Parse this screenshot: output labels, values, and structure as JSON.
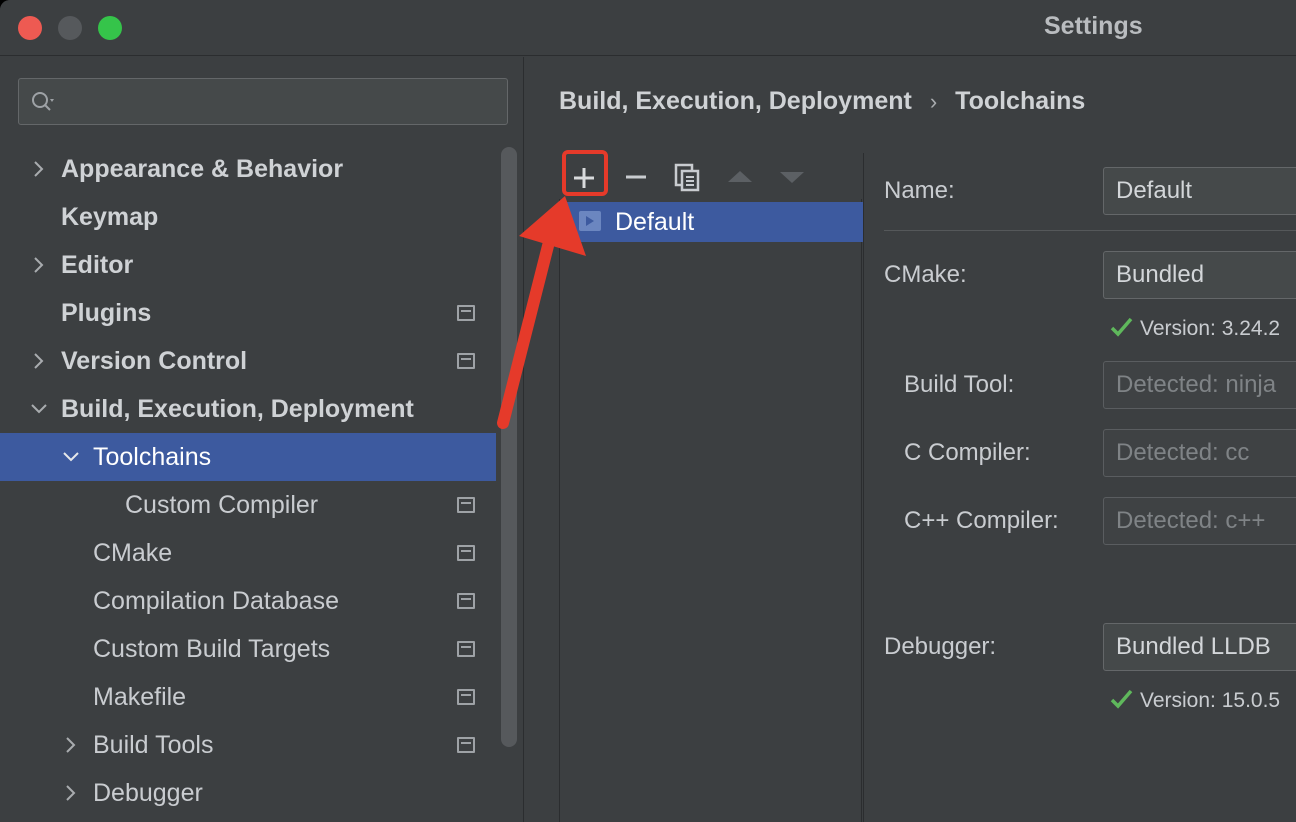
{
  "window": {
    "title": "Settings"
  },
  "search": {
    "placeholder": ""
  },
  "sidebar": {
    "items": [
      {
        "label": "Appearance & Behavior",
        "expandable": true,
        "expanded": false,
        "bold": true,
        "project_icon": false
      },
      {
        "label": "Keymap",
        "expandable": false,
        "bold": true,
        "project_icon": false
      },
      {
        "label": "Editor",
        "expandable": true,
        "expanded": false,
        "bold": true,
        "project_icon": false
      },
      {
        "label": "Plugins",
        "expandable": false,
        "bold": true,
        "project_icon": true
      },
      {
        "label": "Version Control",
        "expandable": true,
        "expanded": false,
        "bold": true,
        "project_icon": true
      },
      {
        "label": "Build, Execution, Deployment",
        "expandable": true,
        "expanded": true,
        "bold": true,
        "project_icon": false
      },
      {
        "label": "Toolchains",
        "expandable": true,
        "expanded": true,
        "selected": true,
        "project_icon": false
      },
      {
        "label": "Custom Compiler",
        "expandable": false,
        "project_icon": true
      },
      {
        "label": "CMake",
        "expandable": false,
        "project_icon": true
      },
      {
        "label": "Compilation Database",
        "expandable": false,
        "project_icon": true
      },
      {
        "label": "Custom Build Targets",
        "expandable": false,
        "project_icon": true
      },
      {
        "label": "Makefile",
        "expandable": false,
        "project_icon": true
      },
      {
        "label": "Build Tools",
        "expandable": true,
        "expanded": false,
        "project_icon": true
      },
      {
        "label": "Debugger",
        "expandable": true,
        "expanded": false,
        "project_icon": false
      }
    ]
  },
  "breadcrumb": {
    "parent": "Build, Execution, Deployment",
    "separator": "›",
    "current": "Toolchains"
  },
  "toolbar": {
    "buttons": [
      "add-icon",
      "remove-icon",
      "copy-icon",
      "move-up-icon",
      "move-down-icon"
    ]
  },
  "toolchains": {
    "items": [
      {
        "label": "Default",
        "selected": true
      }
    ]
  },
  "form": {
    "name_label": "Name:",
    "name_value": "Default",
    "cmake_label": "CMake:",
    "cmake_value": "Bundled",
    "cmake_version": "Version: 3.24.2",
    "build_tool_label": "Build Tool:",
    "build_tool_placeholder": "Detected: ninja",
    "c_compiler_label": "C Compiler:",
    "c_compiler_placeholder": "Detected: cc",
    "cpp_compiler_label": "C++ Compiler:",
    "cpp_compiler_placeholder": "Detected: c++",
    "debugger_label": "Debugger:",
    "debugger_value": "Bundled LLDB",
    "debugger_version": "Version: 15.0.5"
  },
  "colors": {
    "window_bg": "#3c3f41",
    "selection": "#3d5a9f",
    "annotation_red": "#e53a2a",
    "check_green": "#5fb85c"
  }
}
